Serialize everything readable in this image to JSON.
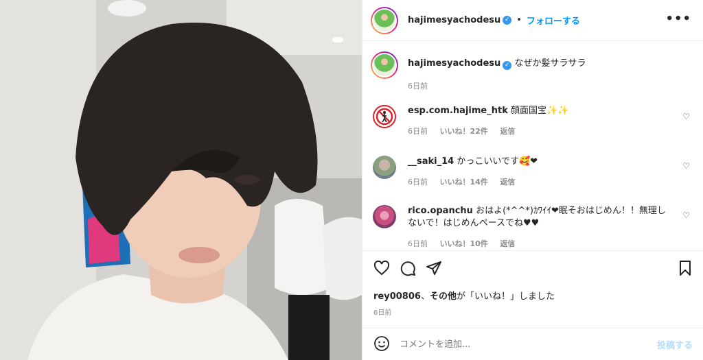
{
  "header": {
    "username": "hajimesyachodesu",
    "separator": "•",
    "follow_label": "フォローする",
    "more_label": "•••"
  },
  "caption": {
    "username": "hajimesyachodesu",
    "text": "なぜか髪サラサラ",
    "time": "6日前"
  },
  "comments": [
    {
      "username": "esp.com.hajime_htk",
      "text": "顔面国宝✨✨",
      "time": "6日前",
      "likes": "いいね！22件",
      "reply": "返信"
    },
    {
      "username": "__saki_14",
      "text": "かっこいいです🥰❤",
      "time": "6日前",
      "likes": "いいね！14件",
      "reply": "返信"
    },
    {
      "username": "rico.opanchu",
      "text": "おはよ(*^^*)ｶﾜｲｲ❤眠そおはじめん！！無理しないで！はじめんペースでね♥♥",
      "time": "6日前",
      "likes": "いいね！10件",
      "reply": "返信"
    }
  ],
  "liked_by": {
    "user": "rey00806",
    "sep": "、",
    "others": "その他",
    "suffix": "が「いいね！」しました"
  },
  "post_date": "6日前",
  "comment_box": {
    "placeholder": "コメントを追加...",
    "post_label": "投稿する"
  },
  "icons": {
    "like": "heart-icon",
    "comment": "comment-icon",
    "share": "share-icon",
    "save": "bookmark-icon",
    "emoji": "emoji-icon",
    "verified": "verified-badge-icon"
  },
  "colors": {
    "link": "#0095f6",
    "verified": "#3897f0",
    "muted": "#8e8e8e",
    "post_disabled": "#b2dffc"
  }
}
